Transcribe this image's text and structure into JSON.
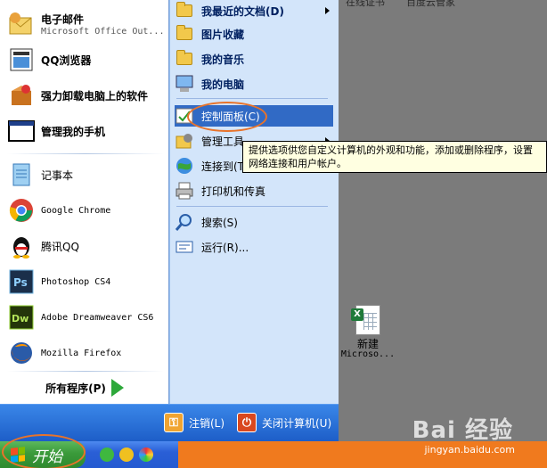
{
  "desktop": {
    "top_labels": [
      "在线证书",
      "百度云管家"
    ],
    "icon": {
      "line1": "新建",
      "line2": "Microso..."
    }
  },
  "start_menu": {
    "left_items": [
      {
        "label": "电子邮件",
        "sub": "Microsoft Office Out...",
        "icon": "outlook-icon"
      },
      {
        "label": "QQ浏览器",
        "icon": "qq-browser-icon"
      },
      {
        "label": "强力卸载电脑上的软件",
        "icon": "uninstall-icon"
      },
      {
        "label": "管理我的手机",
        "icon": "phone-manager-icon"
      },
      {
        "label": "记事本",
        "icon": "notepad-icon"
      },
      {
        "label": "Google Chrome",
        "icon": "chrome-icon"
      },
      {
        "label": "腾讯QQ",
        "icon": "qq-penguin-icon"
      },
      {
        "label": "Photoshop CS4",
        "icon": "photoshop-icon"
      },
      {
        "label": "Adobe Dreamweaver CS6",
        "icon": "dreamweaver-icon"
      },
      {
        "label": "Mozilla Firefox",
        "icon": "firefox-icon"
      }
    ],
    "all_programs": "所有程序(P)",
    "right_items": [
      {
        "label": "我最近的文档(D)",
        "has_arrow": true,
        "icon": "recent-docs-icon"
      },
      {
        "label": "图片收藏",
        "icon": "pictures-folder-icon"
      },
      {
        "label": "我的音乐",
        "icon": "music-folder-icon"
      },
      {
        "label": "我的电脑",
        "icon": "my-computer-icon"
      },
      {
        "label": "控制面板(C)",
        "icon": "control-panel-icon",
        "active": true
      },
      {
        "label": "管理工具",
        "has_arrow": true,
        "icon": "admin-tools-icon"
      },
      {
        "label": "连接到(T)",
        "has_arrow": true,
        "icon": "connect-to-icon"
      },
      {
        "label": "打印机和传真",
        "icon": "printer-icon"
      },
      {
        "label": "搜索(S)",
        "icon": "search-icon"
      },
      {
        "label": "运行(R)...",
        "icon": "run-icon"
      }
    ],
    "tooltip": "提供选项供您自定义计算机的外观和功能，添加或删除程序，设置网络连接和用户帐户。",
    "logoff": "注销(L)",
    "shutdown": "关闭计算机(U)"
  },
  "taskbar": {
    "start_label": "开始"
  },
  "watermark": {
    "brand": "Bai 经验",
    "url": "jingyan.baidu.com"
  },
  "colors": {
    "accent": "#316ac5",
    "highlight_ring": "#e8732a",
    "taskbar_orange": "#f07a1e"
  }
}
